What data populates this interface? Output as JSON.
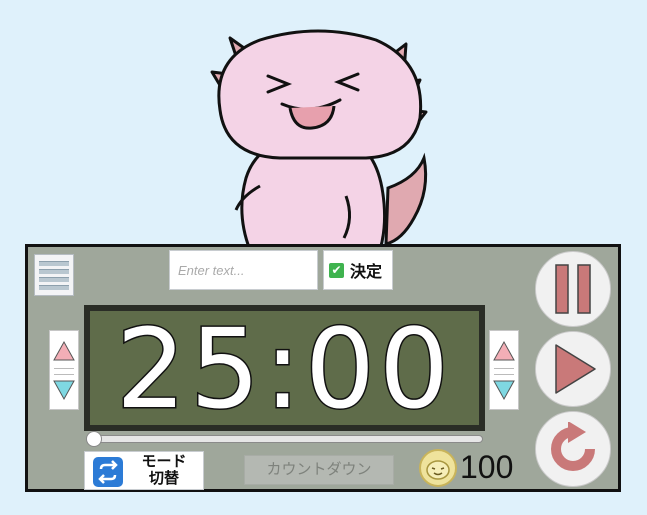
{
  "mascot": {
    "icon": "pink-dinosaur-mascot-icon"
  },
  "menu": {
    "icon": "hamburger-menu-icon"
  },
  "text_input": {
    "placeholder": "Enter text...",
    "value": ""
  },
  "confirm": {
    "label": "決定",
    "icon": "checkmark-icon",
    "color": "#3fb34f"
  },
  "timer": {
    "display": "25:00"
  },
  "left_stepper": {
    "up_icon": "triangle-up-icon",
    "down_icon": "triangle-down-icon"
  },
  "right_stepper": {
    "up_icon": "triangle-up-icon",
    "down_icon": "triangle-down-icon"
  },
  "progress": {
    "value": 0
  },
  "mode_switch": {
    "line1": "モード",
    "line2": "切替",
    "icon": "swap-arrows-icon",
    "color": "#2c7bd6"
  },
  "countdown": {
    "label": "カウントダウン"
  },
  "coins": {
    "count": "100",
    "icon": "coin-mascot-icon"
  },
  "controls": {
    "pause_icon": "pause-icon",
    "play_icon": "play-icon",
    "reset_icon": "reset-icon",
    "accent": "#c97979"
  },
  "colors": {
    "background": "#dff1fb",
    "panel": "#9fa79b",
    "display": "#5f6c4a"
  }
}
